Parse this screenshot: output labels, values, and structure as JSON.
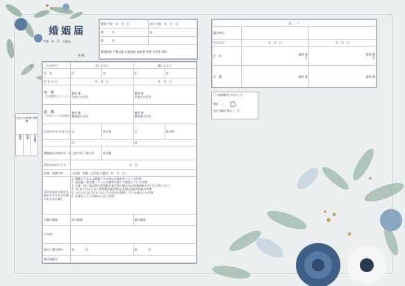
{
  "form": {
    "title": "婚姻届",
    "received_label": "受理 令和　年　月　日",
    "sent_label": "送付 令和　年　月　日",
    "number_label": "第　　　号",
    "long_label": "長",
    "submit_date": "令和　年　月　日届出",
    "mayor": "長 殿"
  },
  "main": {
    "furigana": "（よみかた）",
    "husband_col": "夫になる人",
    "wife_col": "妻になる人",
    "name_row": "氏　名",
    "surname": "氏",
    "given": "名",
    "birth": "生 年 月 日",
    "ymd": "年　月　日",
    "address": "住　所",
    "address_note": "（住民登録をしているところ）",
    "banchi": "番地 番",
    "go": "号",
    "head": "世帯主の氏名",
    "domicile": "本　籍",
    "domicile_note": "（外国人のときは国籍だけを書いてください）",
    "head_domicile": "筆頭者の氏名",
    "parents": "父母の氏名 父母との続き柄",
    "father": "父",
    "mother": "母",
    "zokugara": "続き柄",
    "new_name": "婚姻後の夫婦の氏・新しい本籍",
    "new_name_opts": "□夫の氏 □妻の氏",
    "new_domicile": "新本籍",
    "start_date": "同居を始めたとき",
    "start_ym": "年　月",
    "prior": "初婚・再婚の別",
    "prior_opts": "□初婚　再婚（□死別 □離別　年　月　日）",
    "occupation": "同居を始める前の夫婦のそれぞれの世帯のおもな仕事と",
    "occ_items": [
      "1. 農業だけまたは農業とその他の仕事を持っている世帯",
      "2. 自由業・商工業・サービス業等を個人で経営している世帯",
      "3. 企業・個人商店等の常用勤労者世帯で勤め先の従業者数が1人から99人まで",
      "4. 3にあてはまらない常用勤労者世帯及び会社団体の役員の世帯",
      "5. 1から4にあてはまらないその他の仕事をしている者のいる世帯",
      "6. 仕事をしている者のいない世帯"
    ],
    "job": "夫妻の職業",
    "job_note": "（国勢調査の年… 年…の4月1日から翌年3月31日までに届出をするときだけ書いてください）",
    "husband_job": "夫の職業",
    "wife_job": "妻の職業",
    "other": "その他",
    "signer": "届出人署名押印",
    "sign_h": "夫",
    "sign_w": "妻",
    "seal": "印",
    "case_no": "事件簿番号"
  },
  "witness": {
    "header": "証　　人",
    "sign": "署名押印",
    "birth": "生年月日",
    "ymd": "年　月　日",
    "address": "住　所",
    "domicile": "本　籍",
    "banchi": "番地 番",
    "go": "号"
  },
  "note": {
    "title": "☐ 今後連絡がとれるところ",
    "phone": "電話（　）",
    "home": "自宅 勤務先 呼出（　方）",
    "seal": "印"
  },
  "side": {
    "label": "住定日 住民票 世帯票",
    "cols": [
      "通知",
      "附票",
      "住民票"
    ]
  },
  "colors": {
    "border": "#9aa3ad",
    "text": "#445566",
    "leaf": "#7a9b8a",
    "flower": "#3f5f86"
  }
}
